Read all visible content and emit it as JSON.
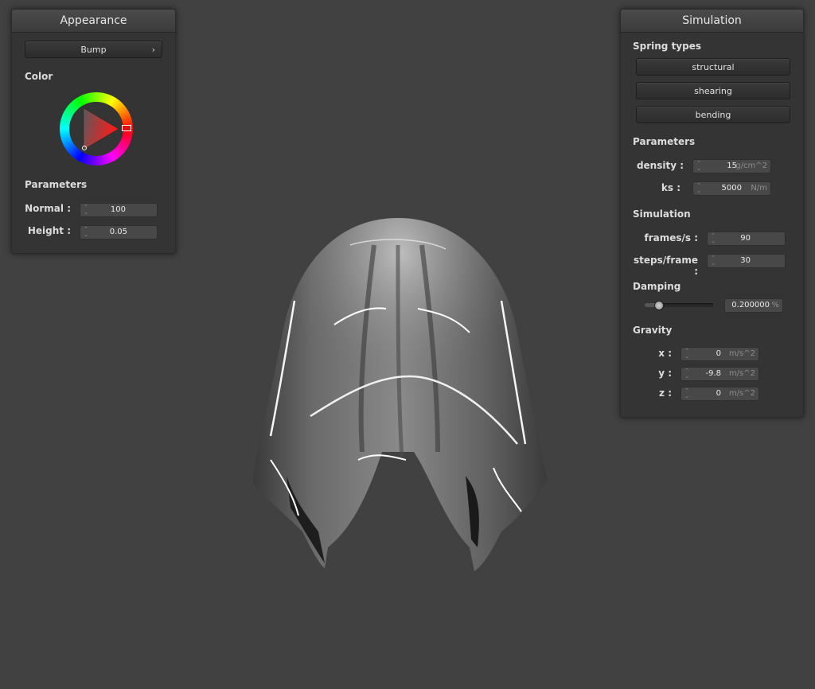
{
  "appearance": {
    "title": "Appearance",
    "mode_button": "Bump",
    "color_label": "Color",
    "params_label": "Parameters",
    "normal_label": "Normal :",
    "normal_value": "100",
    "height_label": "Height :",
    "height_value": "0.05"
  },
  "simulation": {
    "title": "Simulation",
    "spring_types_label": "Spring types",
    "spring_buttons": [
      "structural",
      "shearing",
      "bending"
    ],
    "params_label": "Parameters",
    "density_label": "density :",
    "density_value": "15",
    "density_unit": "g/cm^2",
    "ks_label": "ks :",
    "ks_value": "5000",
    "ks_unit": "N/m",
    "sim_label": "Simulation",
    "fps_label": "frames/s :",
    "fps_value": "90",
    "steps_label": "steps/frame :",
    "steps_value": "30",
    "damping_label": "Damping",
    "damping_value": "0.200000",
    "damping_unit": "%",
    "damping_level": 0.2,
    "gravity_label": "Gravity",
    "gx_label": "x :",
    "gx_value": "0",
    "gy_label": "y :",
    "gy_value": "-9.8",
    "gz_label": "z :",
    "gz_value": "0",
    "gravity_unit": "m/s^2"
  },
  "colors": {
    "background": "#414141",
    "panel": "#343434",
    "selected_color": "#ff2020"
  }
}
